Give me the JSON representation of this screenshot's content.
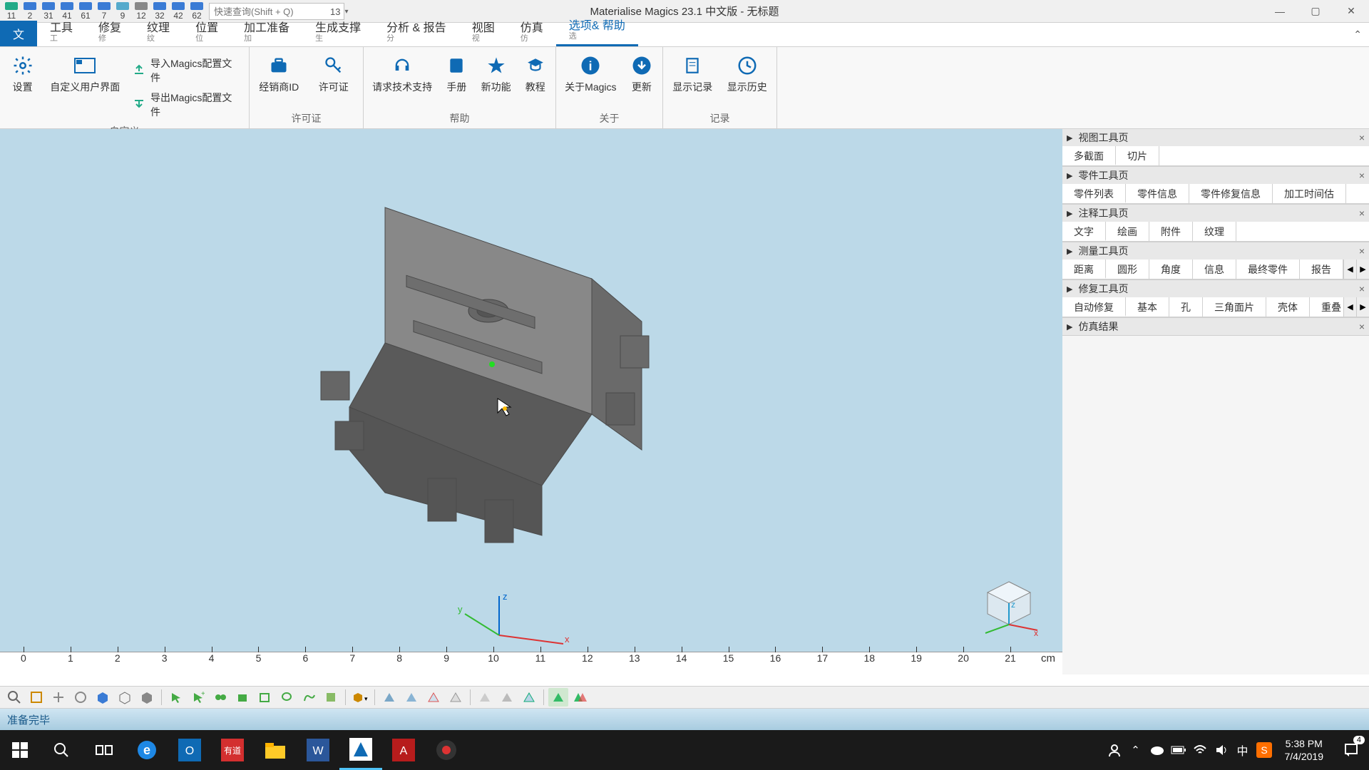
{
  "app": {
    "title": "Materialise Magics 23.1 中文版 - 无标题",
    "minimize": "—",
    "maximize": "▢",
    "close": "✕"
  },
  "qat": {
    "items": [
      {
        "num": "11"
      },
      {
        "num": "2"
      },
      {
        "num": "31"
      },
      {
        "num": "41"
      },
      {
        "num": "61"
      },
      {
        "num": "7"
      },
      {
        "num": "9"
      },
      {
        "num": "12"
      },
      {
        "num": "32"
      },
      {
        "num": "42"
      },
      {
        "num": "62"
      }
    ],
    "search_placeholder": "快速查询(Shift + Q)",
    "search_suffix": "13"
  },
  "ribbon": {
    "tabs": [
      {
        "label": "文",
        "sub": "",
        "id": "file"
      },
      {
        "label": "工具",
        "sub": "工",
        "id": "tools"
      },
      {
        "label": "修复",
        "sub": "修",
        "id": "fix"
      },
      {
        "label": "纹理",
        "sub": "纹",
        "id": "texture"
      },
      {
        "label": "位置",
        "sub": "位",
        "id": "position"
      },
      {
        "label": "加工准备",
        "sub": "加",
        "id": "prep"
      },
      {
        "label": "生成支撑",
        "sub": "生",
        "id": "support"
      },
      {
        "label": "分析 & 报告",
        "sub": "分",
        "id": "analyze"
      },
      {
        "label": "视图",
        "sub": "视",
        "id": "view"
      },
      {
        "label": "仿真",
        "sub": "仿",
        "id": "sim"
      },
      {
        "label": "选项& 帮助",
        "sub": "选",
        "id": "options"
      }
    ],
    "groups": {
      "custom": {
        "label": "自定义",
        "settings": "设置",
        "customize_ui": "自定义用户界面",
        "import_config": "导入Magics配置文件",
        "export_config": "导出Magics配置文件"
      },
      "license": {
        "label": "许可证",
        "dealer_id": "经销商ID",
        "license": "许可证"
      },
      "help": {
        "label": "帮助",
        "support": "请求技术支持",
        "manual": "手册",
        "whatsnew": "新功能",
        "tutorial": "教程"
      },
      "about": {
        "label": "关于",
        "about_magics": "关于Magics",
        "update": "更新"
      },
      "log": {
        "label": "记录",
        "show_log": "显示记录",
        "show_history": "显示历史"
      }
    }
  },
  "viewport": {
    "ruler_ticks": [
      "0",
      "1",
      "2",
      "3",
      "4",
      "5",
      "6",
      "7",
      "8",
      "9",
      "10",
      "11",
      "12",
      "13",
      "14",
      "15",
      "16",
      "17",
      "18",
      "19",
      "20",
      "21"
    ],
    "ruler_unit": "cm",
    "axes": {
      "x": "x",
      "y": "y",
      "z": "z"
    }
  },
  "panels": [
    {
      "title": "视图工具页",
      "tabs": [
        "多截面",
        "切片"
      ]
    },
    {
      "title": "零件工具页",
      "tabs": [
        "零件列表",
        "零件信息",
        "零件修复信息",
        "加工时间估"
      ]
    },
    {
      "title": "注释工具页",
      "tabs": [
        "文字",
        "绘画",
        "附件",
        "纹理"
      ]
    },
    {
      "title": "测量工具页",
      "tabs": [
        "距离",
        "圆形",
        "角度",
        "信息",
        "最终零件",
        "报告"
      ]
    },
    {
      "title": "修复工具页",
      "tabs": [
        "自动修复",
        "基本",
        "孔",
        "三角面片",
        "壳体",
        "重叠"
      ]
    },
    {
      "title": "仿真结果",
      "tabs": []
    }
  ],
  "status": {
    "text": "准备完毕"
  },
  "taskbar": {
    "time": "5:38 PM",
    "date": "7/4/2019",
    "ime": "中",
    "notif_count": "4"
  },
  "colors": {
    "accent": "#0f6ab4",
    "viewport_bg": "#bcd9e8",
    "model": "#6b6b6b"
  }
}
